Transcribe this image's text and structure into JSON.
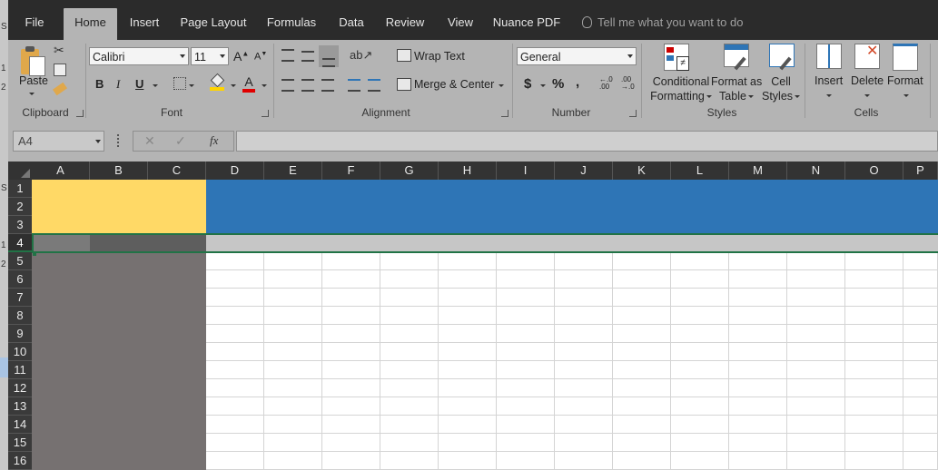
{
  "left_strip": {
    "letters": [
      "S",
      "1",
      "2",
      "S",
      "1",
      "2"
    ]
  },
  "tabs": [
    {
      "label": "File",
      "active": false
    },
    {
      "label": "Home",
      "active": true
    },
    {
      "label": "Insert",
      "active": false
    },
    {
      "label": "Page Layout",
      "active": false
    },
    {
      "label": "Formulas",
      "active": false
    },
    {
      "label": "Data",
      "active": false
    },
    {
      "label": "Review",
      "active": false
    },
    {
      "label": "View",
      "active": false
    },
    {
      "label": "Nuance PDF",
      "active": false
    }
  ],
  "tell_me": "Tell me what you want to do",
  "clipboard": {
    "paste_label": "Paste",
    "group_label": "Clipboard"
  },
  "font": {
    "name": "Calibri",
    "size": "11",
    "bold": "B",
    "italic": "I",
    "underline": "U",
    "grow": "A",
    "shrink": "A",
    "color_letter": "A",
    "group_label": "Font"
  },
  "alignment": {
    "wrap_text": "Wrap Text",
    "merge_center": "Merge & Center",
    "group_label": "Alignment"
  },
  "number": {
    "format": "General",
    "currency": "$",
    "percent": "%",
    "comma": ",",
    "inc_decimal": "←.0 .00",
    "dec_decimal": ".00 →.0",
    "group_label": "Number"
  },
  "styles": {
    "conditional": [
      "Conditional",
      "Formatting"
    ],
    "format_table": [
      "Format as",
      "Table"
    ],
    "cell_styles": [
      "Cell",
      "Styles"
    ],
    "group_label": "Styles"
  },
  "cells": {
    "insert": "Insert",
    "delete": "Delete",
    "format": "Format",
    "group_label": "Cells"
  },
  "formula_bar": {
    "name_box": "A4",
    "cancel": "✕",
    "enter": "✓",
    "fx": "fx",
    "value": ""
  },
  "columns": [
    "A",
    "B",
    "C",
    "D",
    "E",
    "F",
    "G",
    "H",
    "I",
    "J",
    "K",
    "L",
    "M",
    "N",
    "O",
    "P"
  ],
  "rows": [
    "1",
    "2",
    "3",
    "4",
    "5",
    "6",
    "7",
    "8",
    "9",
    "10",
    "11",
    "12",
    "13",
    "14",
    "15",
    "16"
  ],
  "selected_row": "4",
  "colors": {
    "yellow_fill": "#ffd966",
    "blue_fill": "#2e75b6",
    "dark_fill": "#767171",
    "selection": "#217346"
  }
}
